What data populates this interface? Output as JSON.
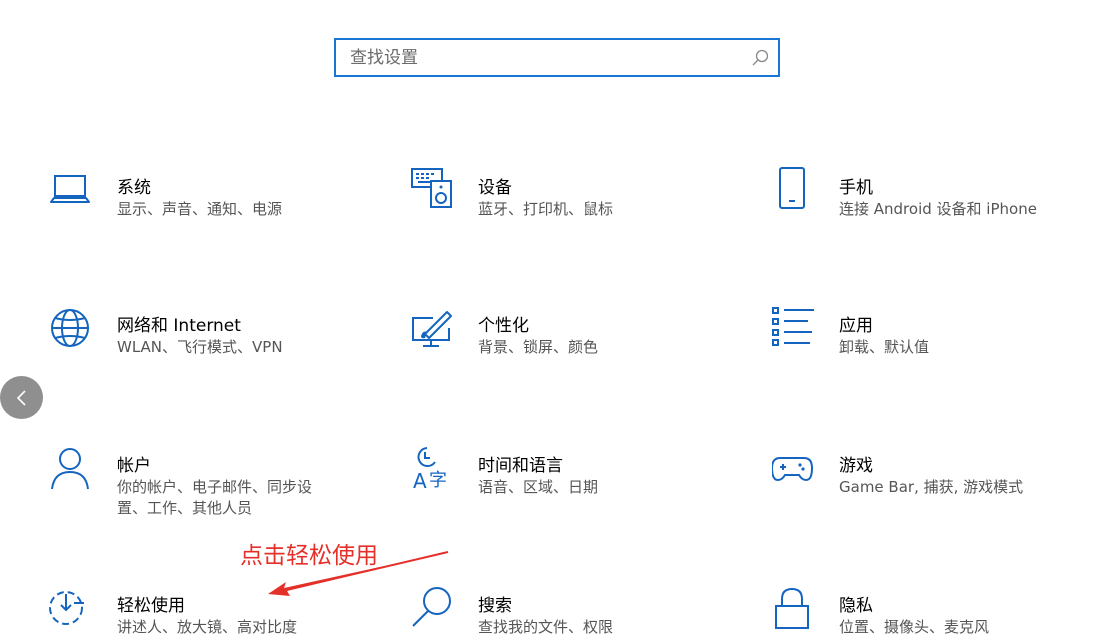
{
  "search": {
    "placeholder": "查找设置",
    "icon": "search-icon"
  },
  "nav": {
    "back_icon": "chevron-left-icon"
  },
  "accent_color": "#1976d2",
  "annotation": {
    "text": "点击轻松使用",
    "color": "#e5302a"
  },
  "tiles": {
    "system": {
      "title": "系统",
      "desc": "显示、声音、通知、电源",
      "icon": "laptop-icon"
    },
    "devices": {
      "title": "设备",
      "desc": "蓝牙、打印机、鼠标",
      "icon": "keyboard-speaker-icon"
    },
    "phone": {
      "title": "手机",
      "desc": "连接 Android 设备和 iPhone",
      "icon": "phone-icon"
    },
    "network": {
      "title": "网络和 Internet",
      "desc": "WLAN、飞行模式、VPN",
      "icon": "globe-icon"
    },
    "personalization": {
      "title": "个性化",
      "desc": "背景、锁屏、颜色",
      "icon": "paint-monitor-icon"
    },
    "apps": {
      "title": "应用",
      "desc": "卸载、默认值",
      "icon": "app-list-icon"
    },
    "accounts": {
      "title": "帐户",
      "desc": "你的帐户、电子邮件、同步设置、工作、其他人员",
      "icon": "person-icon"
    },
    "time_language": {
      "title": "时间和语言",
      "desc": "语音、区域、日期",
      "icon": "clock-language-icon"
    },
    "gaming": {
      "title": "游戏",
      "desc": "Game Bar, 捕获, 游戏模式",
      "icon": "gamepad-icon"
    },
    "ease_of_access": {
      "title": "轻松使用",
      "desc": "讲述人、放大镜、高对比度",
      "icon": "ease-of-access-icon"
    },
    "search": {
      "title": "搜索",
      "desc": "查找我的文件、权限",
      "icon": "magnifier-icon"
    },
    "privacy": {
      "title": "隐私",
      "desc": "位置、摄像头、麦克风",
      "icon": "lock-icon"
    }
  }
}
